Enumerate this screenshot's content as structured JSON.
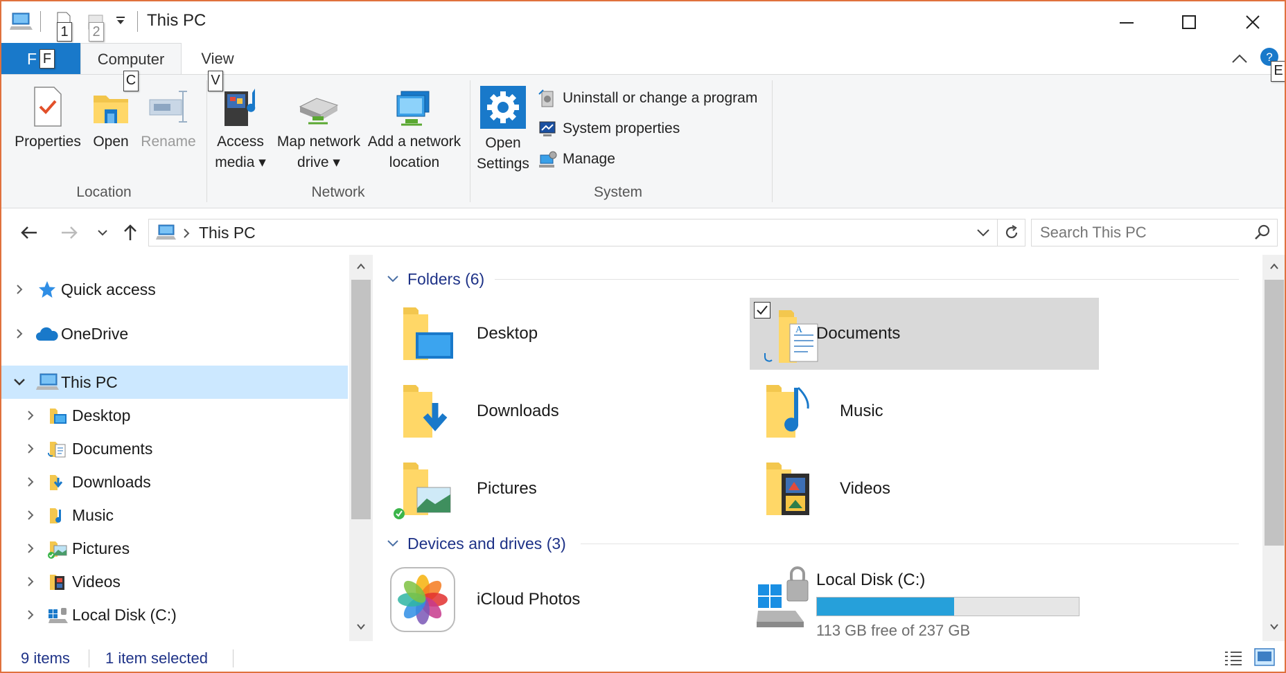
{
  "window": {
    "title": "This PC",
    "qat_keytips": [
      "1",
      "2"
    ],
    "accent": "#1979ca",
    "border_color": "#e0713d"
  },
  "ribbon_tabs": {
    "file_label": "F",
    "file_keytip": "F",
    "tabs": [
      {
        "label": "Computer",
        "keytip": "C",
        "active": true
      },
      {
        "label": "View",
        "keytip": "V",
        "active": false
      }
    ],
    "help_keytip": "E"
  },
  "ribbon": {
    "location": {
      "label": "Location",
      "buttons": [
        {
          "label": "Properties",
          "icon": "properties-checklist-icon",
          "enabled": true
        },
        {
          "label": "Open",
          "icon": "open-folder-icon",
          "enabled": true
        },
        {
          "label": "Rename",
          "icon": "rename-icon",
          "enabled": false
        }
      ]
    },
    "network": {
      "label": "Network",
      "buttons": [
        {
          "line1": "Access",
          "line2": "media",
          "dropdown": true,
          "icon": "access-media-icon"
        },
        {
          "line1": "Map network",
          "line2": "drive",
          "dropdown": true,
          "icon": "map-network-drive-icon"
        },
        {
          "line1": "Add a network",
          "line2": "location",
          "dropdown": false,
          "icon": "network-location-icon"
        }
      ]
    },
    "system": {
      "label": "System",
      "settings": {
        "line1": "Open",
        "line2": "Settings",
        "icon": "settings-gear-icon"
      },
      "items": [
        {
          "label": "Uninstall or change a program",
          "icon": "uninstall-program-icon"
        },
        {
          "label": "System properties",
          "icon": "system-properties-icon"
        },
        {
          "label": "Manage",
          "icon": "manage-computer-icon"
        }
      ]
    }
  },
  "address": {
    "crumb": "This PC",
    "search_placeholder": "Search This PC"
  },
  "nav": {
    "items": [
      {
        "label": "Quick access",
        "icon": "star-icon",
        "level": 0,
        "expanded": false,
        "selected": false
      },
      {
        "label": "OneDrive",
        "icon": "cloud-icon",
        "level": 0,
        "expanded": false,
        "selected": false
      },
      {
        "label": "This PC",
        "icon": "computer-icon",
        "level": 0,
        "expanded": true,
        "selected": true
      },
      {
        "label": "Desktop",
        "icon": "desktop-folder-icon",
        "level": 1,
        "expanded": false,
        "selected": false
      },
      {
        "label": "Documents",
        "icon": "documents-folder-icon",
        "level": 1,
        "expanded": false,
        "selected": false
      },
      {
        "label": "Downloads",
        "icon": "downloads-folder-icon",
        "level": 1,
        "expanded": false,
        "selected": false
      },
      {
        "label": "Music",
        "icon": "music-folder-icon",
        "level": 1,
        "expanded": false,
        "selected": false
      },
      {
        "label": "Pictures",
        "icon": "pictures-folder-icon",
        "level": 1,
        "expanded": false,
        "selected": false
      },
      {
        "label": "Videos",
        "icon": "videos-folder-icon",
        "level": 1,
        "expanded": false,
        "selected": false
      },
      {
        "label": "Local Disk (C:)",
        "icon": "local-disk-icon",
        "level": 1,
        "expanded": false,
        "selected": false
      }
    ]
  },
  "content": {
    "folders_header": "Folders (6)",
    "folders": [
      {
        "label": "Desktop",
        "icon": "desktop-folder-icon",
        "selected": false
      },
      {
        "label": "Documents",
        "icon": "documents-folder-icon",
        "selected": true
      },
      {
        "label": "Downloads",
        "icon": "downloads-folder-icon",
        "selected": false
      },
      {
        "label": "Music",
        "icon": "music-folder-icon",
        "selected": false
      },
      {
        "label": "Pictures",
        "icon": "pictures-folder-icon",
        "selected": false
      },
      {
        "label": "Videos",
        "icon": "videos-folder-icon",
        "selected": false
      }
    ],
    "devices_header": "Devices and drives (3)",
    "devices": [
      {
        "label": "iCloud Photos",
        "icon": "icloud-photos-icon"
      },
      {
        "label": "Local Disk (C:)",
        "icon": "windows-drive-icon",
        "free_text": "113 GB free of 237 GB",
        "used_fraction": 0.523,
        "bar_color": "#26a0da"
      }
    ]
  },
  "status": {
    "items_count": "9 items",
    "selection": "1 item selected"
  }
}
